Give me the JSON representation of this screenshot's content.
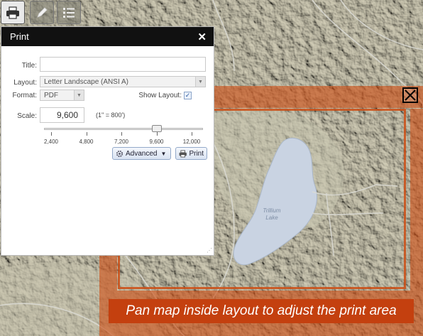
{
  "toolbar": {
    "tools": [
      {
        "icon": "printer-icon",
        "active": true
      },
      {
        "icon": "pencil-icon",
        "active": false
      },
      {
        "icon": "list-icon",
        "active": false
      }
    ]
  },
  "panel": {
    "title": "Print",
    "close_label": "✕",
    "title_field": {
      "label": "Title:",
      "value": ""
    },
    "layout_field": {
      "label": "Layout:",
      "value": "Letter Landscape (ANSI A)"
    },
    "format_field": {
      "label": "Format:",
      "value": "PDF"
    },
    "show_layout": {
      "label": "Show Layout:",
      "checked": true
    },
    "scale": {
      "label": "Scale:",
      "value": "9,600",
      "ratio_text": "(1\" = 800')",
      "ticks": [
        "2,400",
        "4,800",
        "7,200",
        "9,600",
        "12,000"
      ],
      "level_fraction": 0.75
    },
    "advanced_button": "Advanced",
    "print_button": "Print"
  },
  "map": {
    "lake_label_line1": "Trillium",
    "lake_label_line2": "Lake"
  },
  "layout_overlay": {
    "banner_text": "Pan map inside layout to adjust the print area",
    "accent_color": "#c4400f"
  }
}
